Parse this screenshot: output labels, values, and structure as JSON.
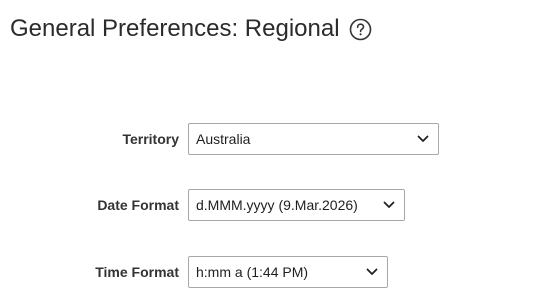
{
  "header": {
    "title": "General Preferences: Regional",
    "help_icon": "help-circle-icon"
  },
  "form": {
    "territory": {
      "label": "Territory",
      "value": "Australia",
      "icon": "chevron-down-icon"
    },
    "date_format": {
      "label": "Date Format",
      "value": "d.MMM.yyyy (9.Mar.2026)",
      "icon": "chevron-down-icon"
    },
    "time_format": {
      "label": "Time Format",
      "value": "h:mm a (1:44 PM)",
      "icon": "chevron-down-icon"
    }
  }
}
